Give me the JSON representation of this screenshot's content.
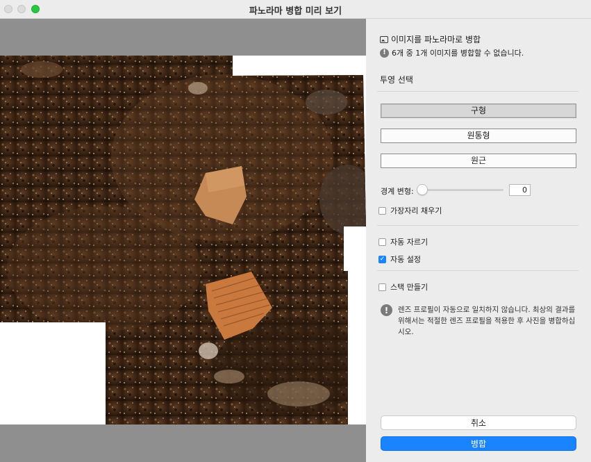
{
  "window": {
    "title": "파노라마 병합 미리 보기"
  },
  "panel": {
    "header": "이미지를 파노라마로 병합",
    "warning": "6개 중 1개 이미지를 병합할 수 없습니다.",
    "projection_label": "투영 선택",
    "projections": [
      {
        "label": "구형",
        "selected": true
      },
      {
        "label": "원통형",
        "selected": false
      },
      {
        "label": "원근",
        "selected": false
      }
    ],
    "boundary_label": "경계 변형:",
    "boundary_value": "0",
    "fill_edges": {
      "label": "가장자리 채우기",
      "checked": false
    },
    "auto_crop": {
      "label": "자동 자르기",
      "checked": false
    },
    "auto_settings": {
      "label": "자동 설정",
      "checked": true
    },
    "create_stack": {
      "label": "스택 만들기",
      "checked": false
    },
    "lens_note": "렌즈 프로필이 자동으로 일치하지 않습니다. 최상의 결과를 위해서는 적절한 렌즈 프로필을 적용한 후 사진을 병합하십시오.",
    "cancel_label": "취소",
    "merge_label": "병합"
  },
  "icons": {
    "header_icon": "panorama-image-icon",
    "warning_icon": "exclamation-circle-icon",
    "note_icon": "exclamation-circle-icon",
    "check_icon": "checkmark-icon"
  },
  "colors": {
    "accent": "#1a84ff",
    "preview_bg": "#8f8f8f",
    "panel_bg": "#ececec"
  }
}
